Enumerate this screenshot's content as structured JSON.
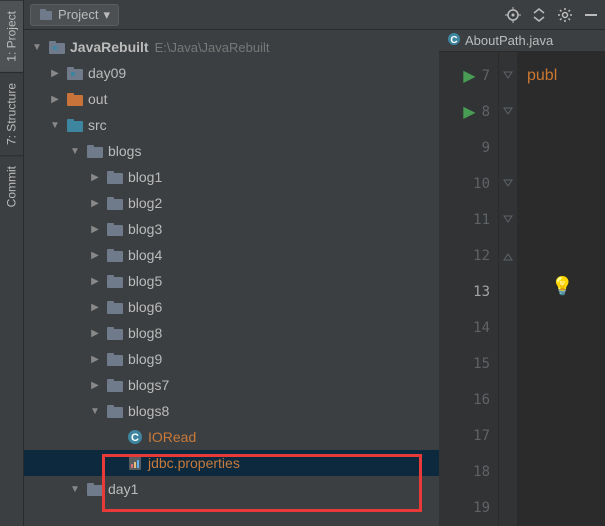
{
  "gutter": {
    "project": "1: Project",
    "structure": "7: Structure",
    "commit": "Commit"
  },
  "topbar": {
    "project_label": "Project",
    "dropdown_arrow": "▾"
  },
  "editor": {
    "tab_label": "AboutPath.java",
    "code_snippet": "publ",
    "lines": [
      "7",
      "8",
      "9",
      "10",
      "11",
      "12",
      "13",
      "14",
      "15",
      "16",
      "17",
      "18",
      "19"
    ]
  },
  "tree": {
    "root": {
      "name": "JavaRebuilt",
      "path": "E:\\Java\\JavaRebuilt"
    },
    "day09": "day09",
    "out": "out",
    "src": "src",
    "blogs": "blogs",
    "items": [
      "blog1",
      "blog2",
      "blog3",
      "blog4",
      "blog5",
      "blog6",
      "blog8",
      "blog9",
      "blogs7",
      "blogs8"
    ],
    "ioread": "IORead",
    "jdbc": "jdbc.properties",
    "day1": "day1"
  }
}
